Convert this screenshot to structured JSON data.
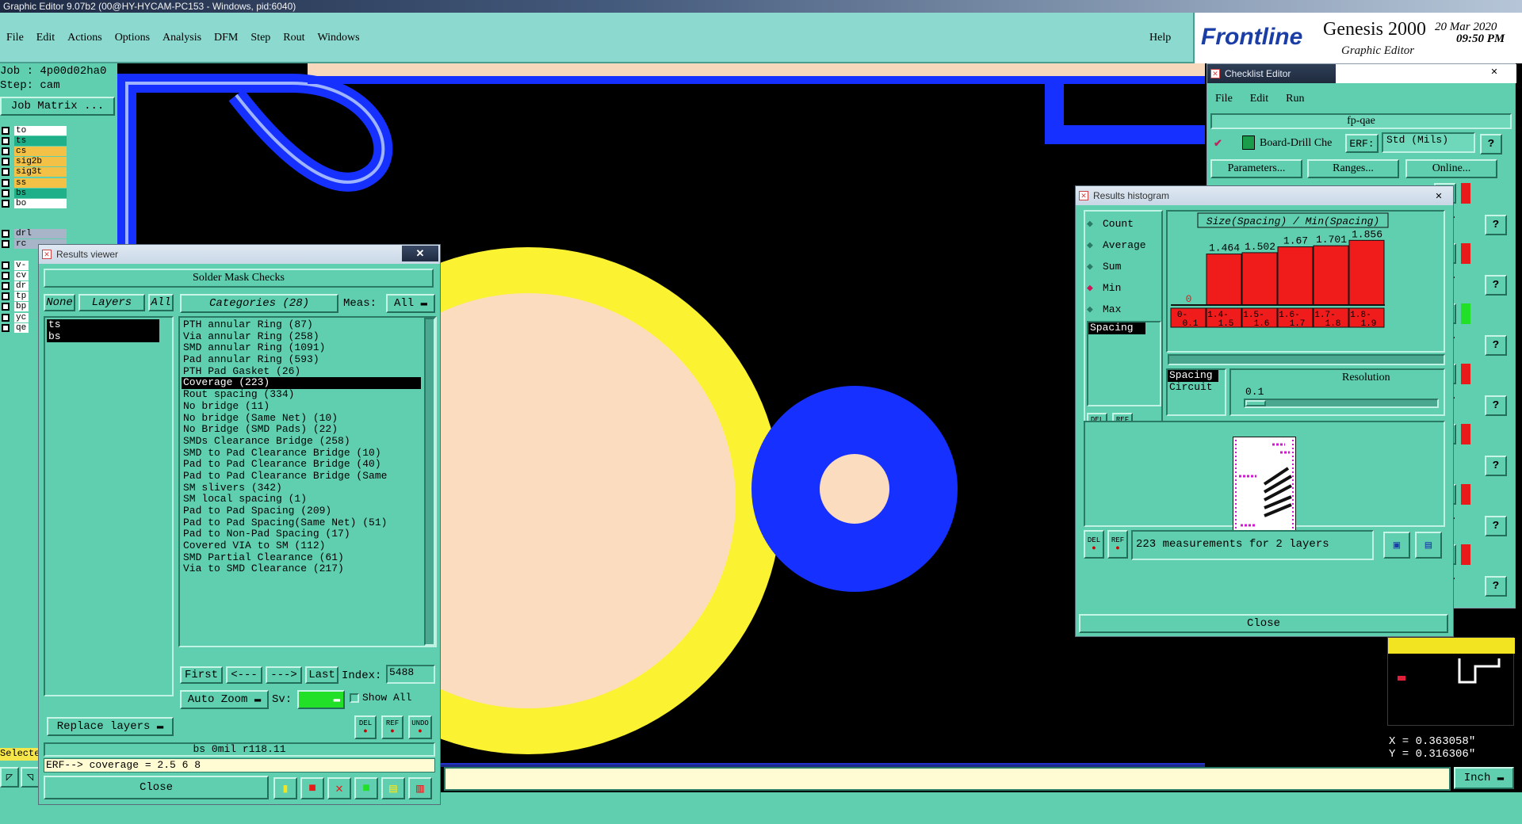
{
  "window": {
    "title": "Graphic Editor 9.07b2 (00@HY-HYCAM-PC153 - Windows, pid:6040)"
  },
  "menu": {
    "items": [
      "File",
      "Edit",
      "Actions",
      "Options",
      "Analysis",
      "DFM",
      "Step",
      "Rout",
      "Windows"
    ],
    "help": "Help"
  },
  "brand": {
    "logo": "Frontline",
    "product": "Genesis 2000",
    "subtitle": "Graphic Editor",
    "date": "20 Mar 2020",
    "time": "09:50 PM"
  },
  "left": {
    "job": "Job : 4p00d02ha0",
    "step": "Step: cam",
    "job_matrix": "Job Matrix ...",
    "layers": [
      {
        "name": "to",
        "color": "#ffffff"
      },
      {
        "name": "ts",
        "color": "#1fb08a"
      },
      {
        "name": "cs",
        "color": "#f2c146"
      },
      {
        "name": "sig2b",
        "color": "#f2c146"
      },
      {
        "name": "sig3t",
        "color": "#f2c146"
      },
      {
        "name": "ss",
        "color": "#f2c146"
      },
      {
        "name": "bs",
        "color": "#1fb08a"
      },
      {
        "name": "bo",
        "color": "#ffffff"
      }
    ],
    "layers2": [
      {
        "name": "drl",
        "color": "#a8b4c8"
      },
      {
        "name": "rc",
        "color": "#a8b4c8"
      }
    ],
    "layers3": [
      "v-",
      "cv",
      "dr",
      "tp",
      "bp",
      "yc",
      "qe"
    ],
    "selected_label": "Selecte"
  },
  "results_viewer": {
    "title": "Results viewer",
    "header": "Solder Mask Checks",
    "none_btn": "None",
    "layers_btn": "Layers",
    "all_btn": "All",
    "categories_btn": "Categories (28)",
    "meas_label": "Meas:",
    "meas_value": "All",
    "selected_layers": [
      "ts",
      "bs"
    ],
    "categories": [
      "PTH annular Ring (87)",
      "Via annular Ring (258)",
      "SMD annular Ring (1091)",
      "Pad annular Ring (593)",
      "PTH Pad Gasket (26)",
      "Coverage (223)",
      "Rout spacing (334)",
      "No bridge (11)",
      "No bridge (Same Net) (10)",
      "No Bridge (SMD Pads) (22)",
      "SMDs Clearance Bridge (258)",
      "SMD to Pad Clearance Bridge (10)",
      "Pad to Pad Clearance Bridge (40)",
      "Pad to Pad Clearance Bridge (Same",
      "SM slivers (342)",
      "SM local spacing (1)",
      "Pad to Pad Spacing (209)",
      "Pad to Pad Spacing(Same Net) (51)",
      "Pad to Non-Pad Spacing (17)",
      "Covered VIA to SM (112)",
      "SMD Partial Clearance (61)",
      "Via to SMD Clearance (217)"
    ],
    "selected_category_index": 5,
    "nav": {
      "first": "First",
      "prev": "<---",
      "next": "--->",
      "last": "Last",
      "index_label": "Index:",
      "index_value": "5488"
    },
    "auto_zoom": "Auto Zoom",
    "sv_label": "Sv:",
    "show_all": "Show All",
    "replace_layers": "Replace layers",
    "status": "bs 0mil   r118.11",
    "erf_line": "ERF--> coverage = 2.5 6 8",
    "close": "Close",
    "icon_labels": {
      "del": "DEL",
      "ref": "REF",
      "undo": "UNDO"
    }
  },
  "checklist": {
    "title": "Checklist Editor",
    "menu": [
      "File",
      "Edit",
      "Run"
    ],
    "name": "fp-qae",
    "action": "Board-Drill Che",
    "erf_label": "ERF:",
    "erf_value": "Std (Mils)",
    "parameters": "Parameters...",
    "ranges": "Ranges...",
    "online": "Online...",
    "right_fragments": [
      "e...",
      "e...",
      "e...",
      "e...",
      "ed",
      "e...",
      "e..."
    ]
  },
  "histogram": {
    "title": "Results histogram",
    "modes": [
      "Count",
      "Average",
      "Sum",
      "Min",
      "Max"
    ],
    "selected_mode": "Min",
    "measure": "Spacing",
    "chart_title": "Size(Spacing) / Min(Spacing)",
    "resolution_label": "Resolution",
    "resolution_value": "0.1",
    "list2": [
      "Spacing",
      "Circuit"
    ],
    "summary": "223 measurements for 2 layers",
    "close": "Close",
    "del": "DEL",
    "ref": "REF"
  },
  "chart_data": {
    "type": "bar",
    "title": "Size(Spacing) / Min(Spacing)",
    "categories": [
      "0-0.1",
      "1.4-1.5",
      "1.5-1.6",
      "1.6-1.7",
      "1.7-1.8",
      "1.8-1.9"
    ],
    "category_lines": [
      [
        "0-",
        "0.1"
      ],
      [
        "1.4-",
        "1.5"
      ],
      [
        "1.5-",
        "1.6"
      ],
      [
        "1.6-",
        "1.7"
      ],
      [
        "1.7-",
        "1.8"
      ],
      [
        "1.8-",
        "1.9"
      ]
    ],
    "values": [
      0,
      1.464,
      1.502,
      1.67,
      1.701,
      1.856
    ],
    "labels": [
      "0",
      "1.464",
      "1.502",
      "1.67",
      "1.701",
      "1.856"
    ],
    "ylim": [
      0,
      2.0
    ],
    "bar_color": "#f01c1c"
  },
  "coords": {
    "x": "X = 0.363058\"",
    "y": "Y = 0.316306\""
  },
  "units": "Inch"
}
